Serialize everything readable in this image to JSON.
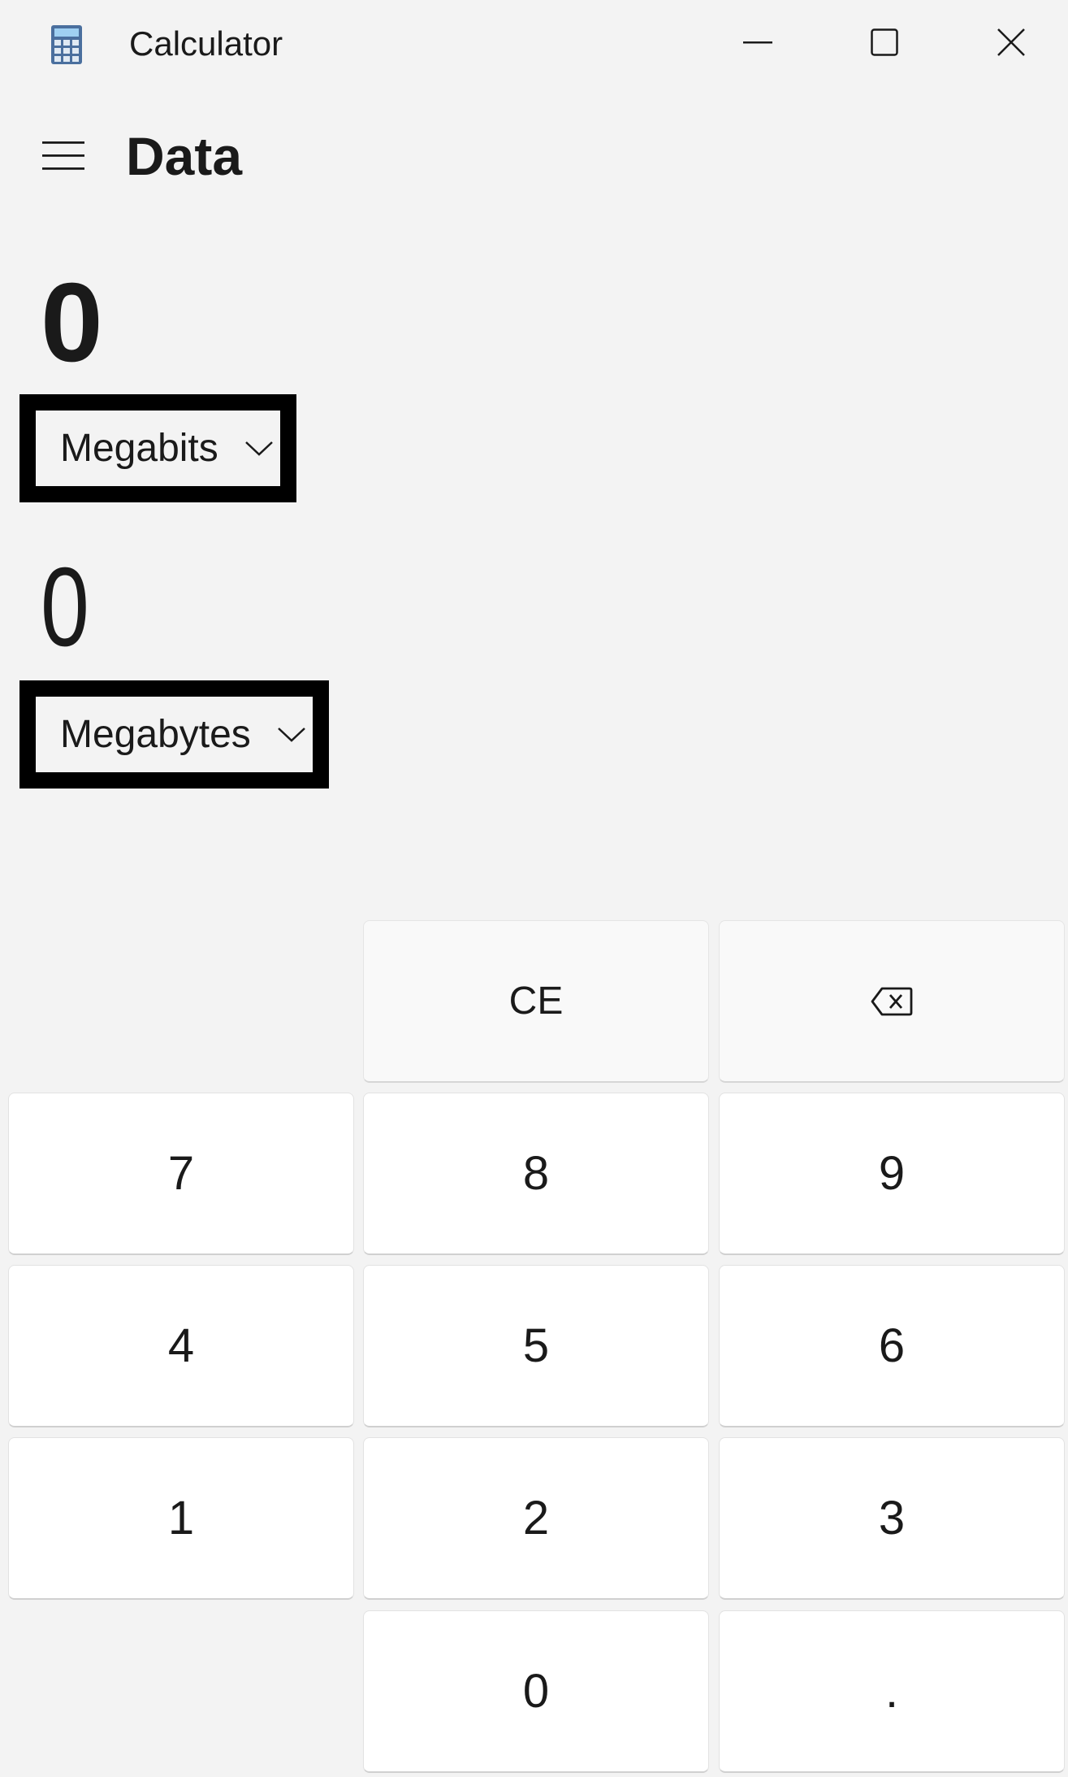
{
  "titlebar": {
    "title": "Calculator",
    "icon": "calculator-app-icon",
    "minimize_icon": "minimize-icon",
    "maximize_icon": "maximize-icon",
    "close_icon": "close-icon"
  },
  "header": {
    "menu_icon": "hamburger-menu-icon",
    "mode": "Data"
  },
  "converter": {
    "from_value": "0",
    "from_unit": "Megabits",
    "to_value": "0",
    "to_unit": "Megabytes",
    "chevron_icon": "chevron-down-icon"
  },
  "keypad": {
    "clear_entry": "CE",
    "backspace_icon": "backspace-icon",
    "k7": "7",
    "k8": "8",
    "k9": "9",
    "k4": "4",
    "k5": "5",
    "k6": "6",
    "k1": "1",
    "k2": "2",
    "k3": "3",
    "k0": "0",
    "decimal": "."
  },
  "colors": {
    "background": "#f3f3f3",
    "key_number": "#ffffff",
    "key_function": "#f9f9f9",
    "highlight_border": "#000000"
  }
}
